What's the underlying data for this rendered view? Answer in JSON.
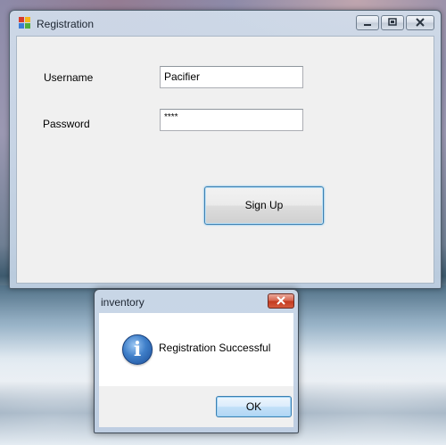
{
  "registration_window": {
    "title": "Registration",
    "username_label": "Username",
    "username_value": "Pacifier",
    "password_label": "Password",
    "password_value": "****",
    "signup_label": "Sign Up",
    "caption_buttons": [
      "minimize-icon",
      "maximize-icon",
      "close-icon"
    ]
  },
  "message_box": {
    "title": "inventory",
    "icon": "info-icon",
    "message": "Registration Successful",
    "ok_label": "OK"
  },
  "colors": {
    "accent_border": "#3c7fb1",
    "close_red": "#c2391f",
    "info_blue": "#1c4e98"
  }
}
